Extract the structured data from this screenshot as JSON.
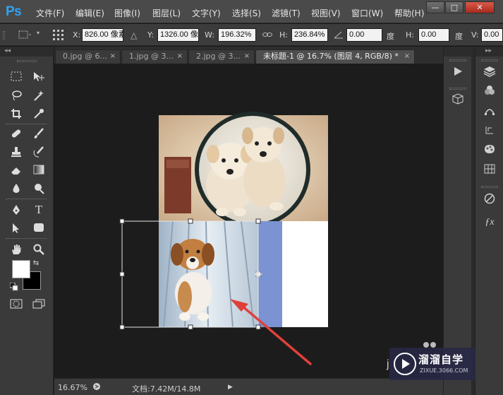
{
  "app": {
    "logo": "Ps"
  },
  "menu": [
    "文件(F)",
    "编辑(E)",
    "图像(I)",
    "图层(L)",
    "文字(Y)",
    "选择(S)",
    "滤镜(T)",
    "视图(V)",
    "窗口(W)",
    "帮助(H)"
  ],
  "window_controls": {
    "minimize": "—",
    "maximize": "□",
    "close": "✕"
  },
  "options_bar": {
    "x_label": "X:",
    "x_value": "826.00 像素",
    "y_label": "Y:",
    "y_value": "1326.00 像",
    "w_label": "W:",
    "w_value": "196.32%",
    "h_label": "H:",
    "h_value": "236.84%",
    "angle_value": "0.00",
    "angle_unit": "度",
    "hskew_label": "H:",
    "hskew_value": "0.00",
    "hskew_unit": "度",
    "vskew_label": "V:",
    "vskew_value": "0.00"
  },
  "tabs": [
    {
      "label": "0.jpg @ 6...",
      "active": false
    },
    {
      "label": "1.jpg @ 3...",
      "active": false
    },
    {
      "label": "2.jpg @ 3...",
      "active": false
    },
    {
      "label": "未标题-1 @ 16.7% (图层 4, RGB/8) *",
      "active": true
    }
  ],
  "tab_close": "×",
  "status": {
    "zoom": "16.67%",
    "doc_info": "文档:7.42M/14.8M"
  },
  "watermark": {
    "title": "溜溜自学",
    "url": "ZIXUE.3066.COM",
    "partial_letter": "j"
  },
  "colors": {
    "accent": "#2fa3f5",
    "arrow": "#e0403a",
    "foreground": "#ffffff",
    "background": "#000000",
    "canvas_fill": "#7b93d3"
  }
}
